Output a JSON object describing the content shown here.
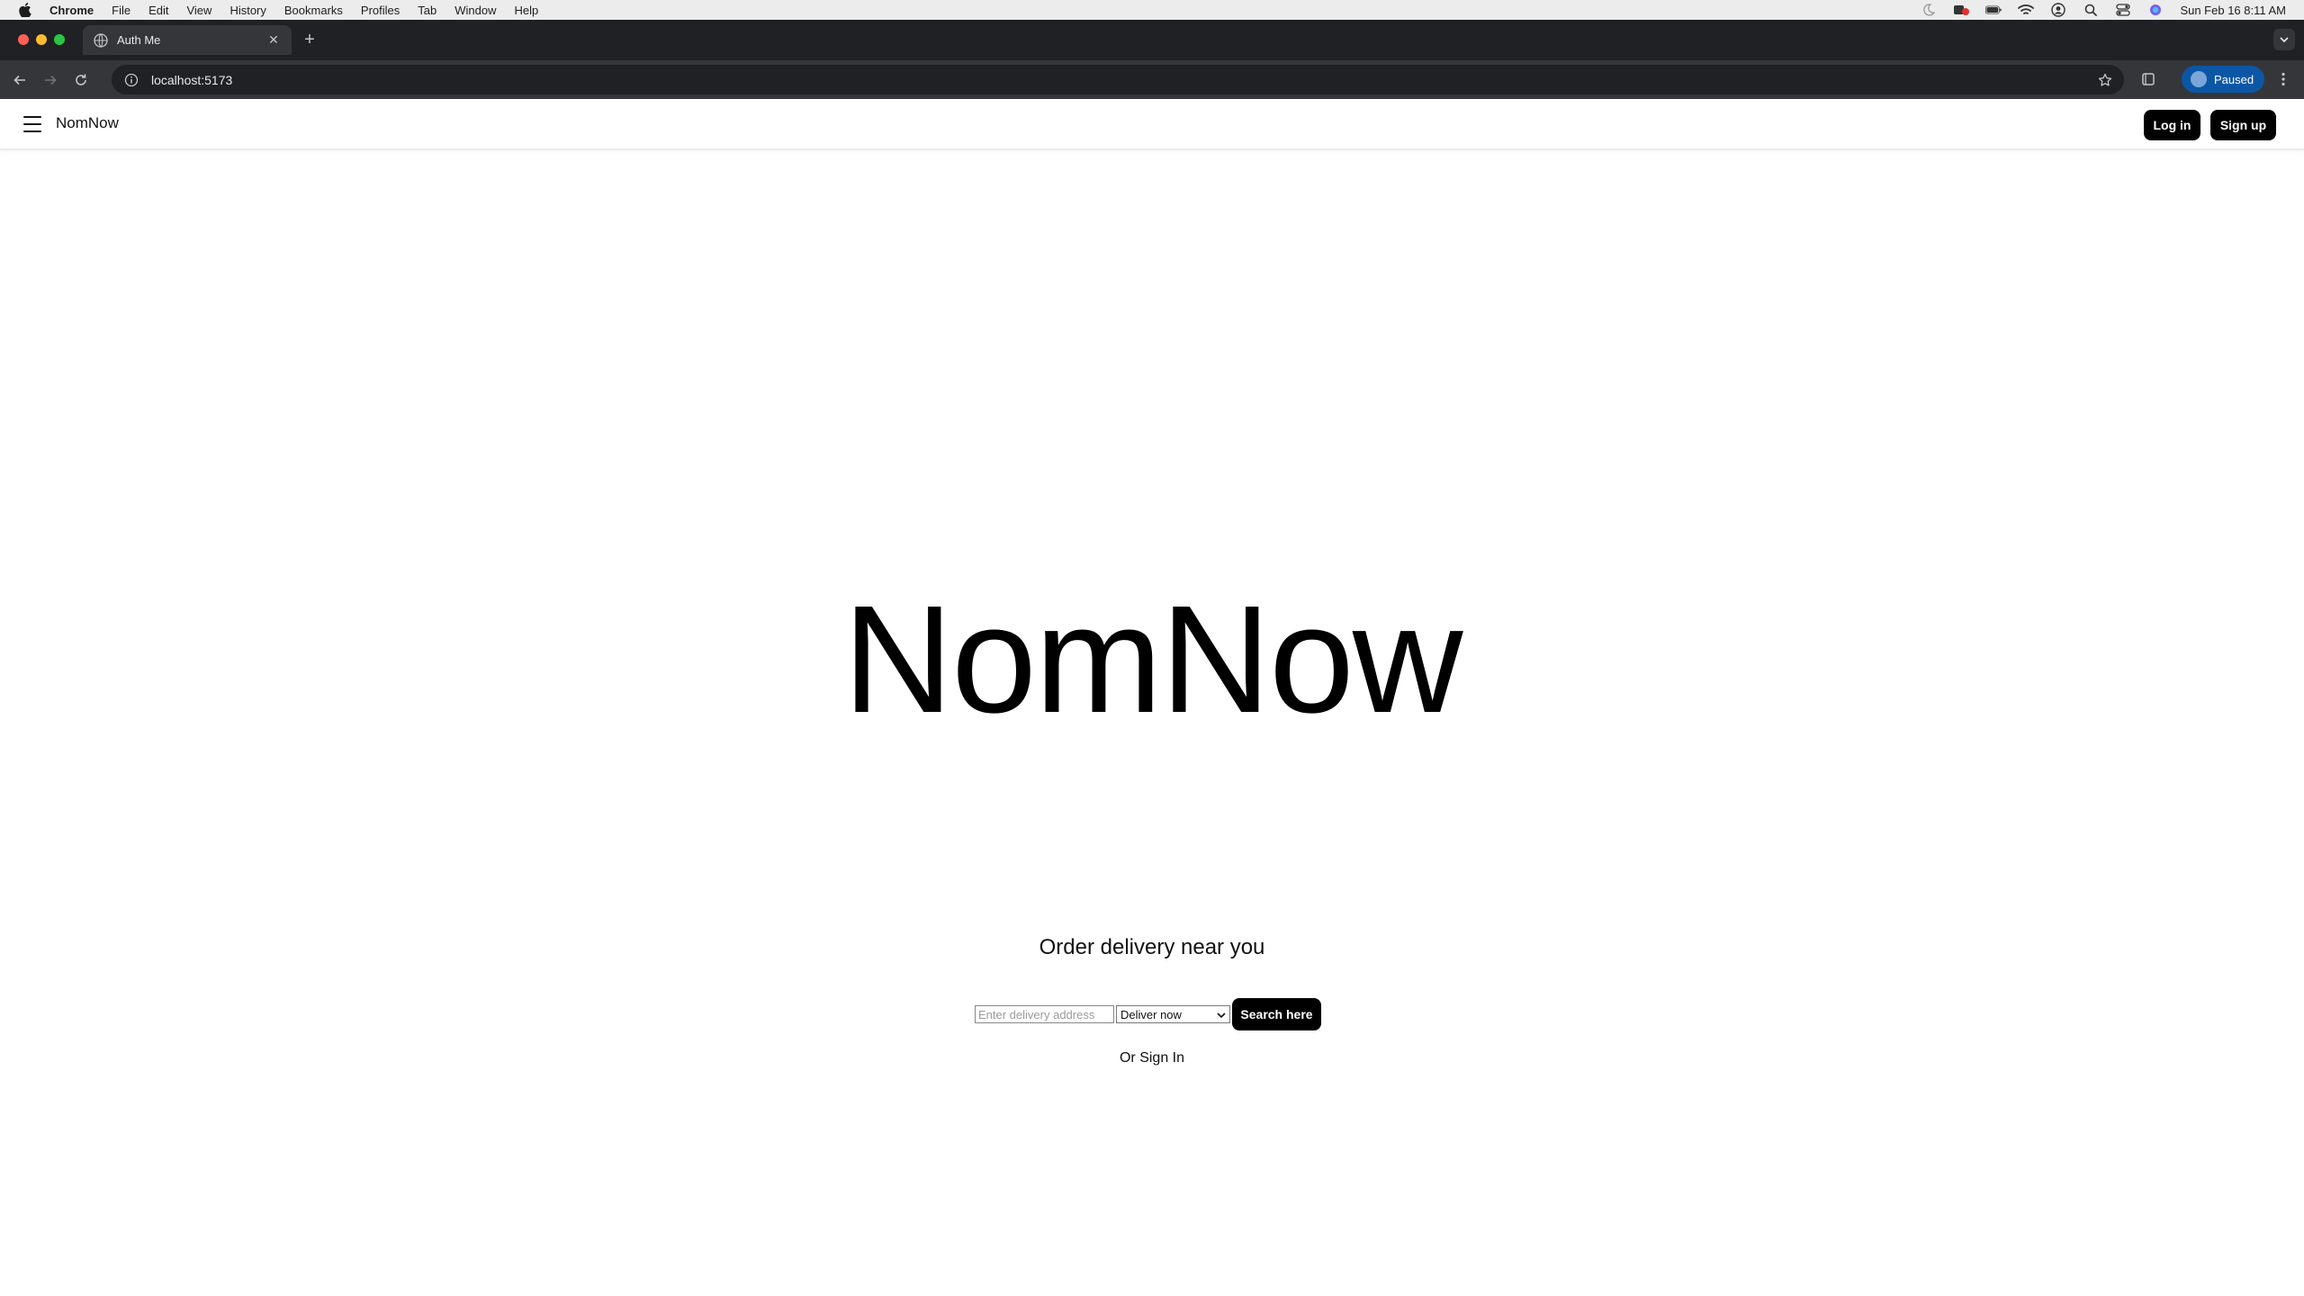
{
  "menubar": {
    "app": "Chrome",
    "items": [
      "File",
      "Edit",
      "View",
      "History",
      "Bookmarks",
      "Profiles",
      "Tab",
      "Window",
      "Help"
    ],
    "datetime": "Sun Feb 16  8:11 AM"
  },
  "browser": {
    "tab_title": "Auth Me",
    "url": "localhost:5173",
    "profile_status": "Paused",
    "accent": "#0b57a6"
  },
  "app": {
    "brand": "NomNow",
    "login_label": "Log in",
    "signup_label": "Sign up",
    "hero_title": "NomNow",
    "subtitle": "Order delivery near you",
    "address_placeholder": "Enter delivery address",
    "deliver_option": "Deliver now",
    "search_label": "Search here",
    "signin_link": "Or Sign In"
  }
}
